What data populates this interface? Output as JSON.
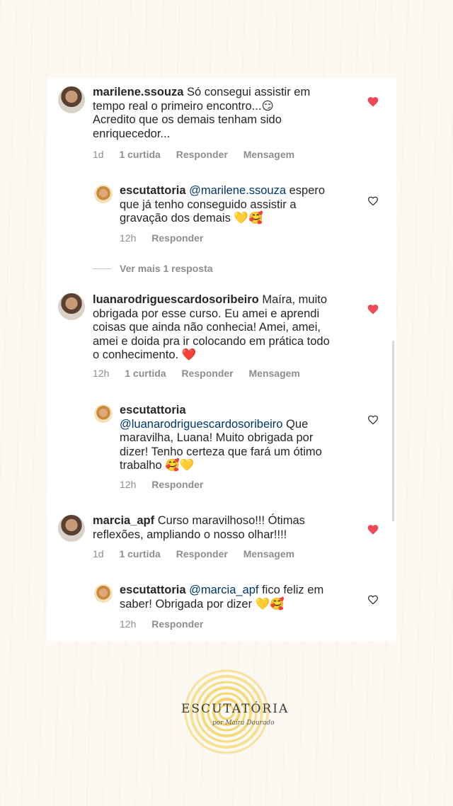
{
  "colors": {
    "like_red": "#ed4956",
    "meta_gray": "#8e8e8e",
    "mention_blue": "#00376b",
    "logo_yellow": "#f2cf55"
  },
  "comments": [
    {
      "username": "marilene.ssouza",
      "text_lines": [
        "Só consegui assistir em",
        "tempo real o primeiro encontro...😏",
        "Acredito que os demais tenham sido",
        "enriquecedor..."
      ],
      "meta": {
        "time": "1d",
        "likes": "1 curtida",
        "reply": "Responder",
        "message": "Mensagem"
      },
      "liked": true,
      "reply": {
        "username": "escutattoria",
        "mention": "@marilene.ssouza",
        "text_lines": [
          " espero",
          "que já tenho conseguido assistir a",
          "gravação dos demais 💛🥰"
        ],
        "meta": {
          "time": "12h",
          "reply": "Responder"
        }
      },
      "view_more": "Ver mais 1 resposta"
    },
    {
      "username": "luanarodriguescardosoribeiro",
      "text_lines": [
        " Maíra, muito",
        "obrigada por esse curso. Eu amei e aprendi",
        "coisas que ainda não conhecia! Amei, amei,",
        "amei e doida pra ir colocando em prática todo",
        "o conhecimento. ❤️"
      ],
      "meta": {
        "time": "12h",
        "likes": "1 curtida",
        "reply": "Responder",
        "message": "Mensagem"
      },
      "liked": true,
      "reply": {
        "username": "escutattoria",
        "mention": "@luanarodriguescardosoribeiro",
        "text_lines": [
          " Que",
          "maravilha, Luana! Muito obrigada por",
          "dizer! Tenho certeza que fará um ótimo",
          "trabalho 🥰💛"
        ],
        "meta": {
          "time": "12h",
          "reply": "Responder"
        }
      }
    },
    {
      "username": "marcia_apf",
      "text_lines": [
        " Curso maravilhoso!!! Ótimas",
        "reflexões, ampliando o nosso olhar!!!!"
      ],
      "meta": {
        "time": "1d",
        "likes": "1 curtida",
        "reply": "Responder",
        "message": "Mensagem"
      },
      "liked": true,
      "reply": {
        "username": "escutattoria",
        "mention": "@marcia_apf",
        "text_lines": [
          " fico feliz em",
          "saber! Obrigada por dizer 💛🥰"
        ],
        "meta": {
          "time": "12h",
          "reply": "Responder"
        }
      }
    }
  ],
  "logo": {
    "title": "ESCUTATÓRIA",
    "subtitle": "por Maíra Dourado"
  }
}
